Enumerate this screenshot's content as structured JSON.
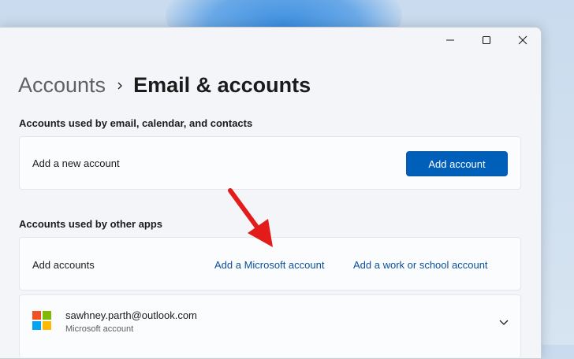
{
  "window": {
    "controls": {
      "minimize": "minimize",
      "maximize": "maximize",
      "close": "close"
    }
  },
  "breadcrumb": {
    "parent": "Accounts",
    "current": "Email & accounts"
  },
  "email_section": {
    "title": "Accounts used by email, calendar, and contacts",
    "row_label": "Add a new account",
    "button_label": "Add account"
  },
  "other_apps_section": {
    "title": "Accounts used by other apps",
    "row_label": "Add accounts",
    "link_microsoft": "Add a Microsoft account",
    "link_work": "Add a work or school account"
  },
  "account": {
    "email": "sawhney.parth@outlook.com",
    "type": "Microsoft account"
  },
  "colors": {
    "accent": "#005fb8",
    "link": "#0b4f9c",
    "annotation_arrow": "#e31b1b",
    "ms_red": "#f25022",
    "ms_green": "#7fba00",
    "ms_blue": "#00a4ef",
    "ms_yellow": "#ffb900"
  },
  "icons": [
    "minimize-icon",
    "maximize-icon",
    "close-icon",
    "chevron-right-icon",
    "microsoft-logo-icon",
    "chevron-down-icon",
    "annotation-arrow"
  ]
}
